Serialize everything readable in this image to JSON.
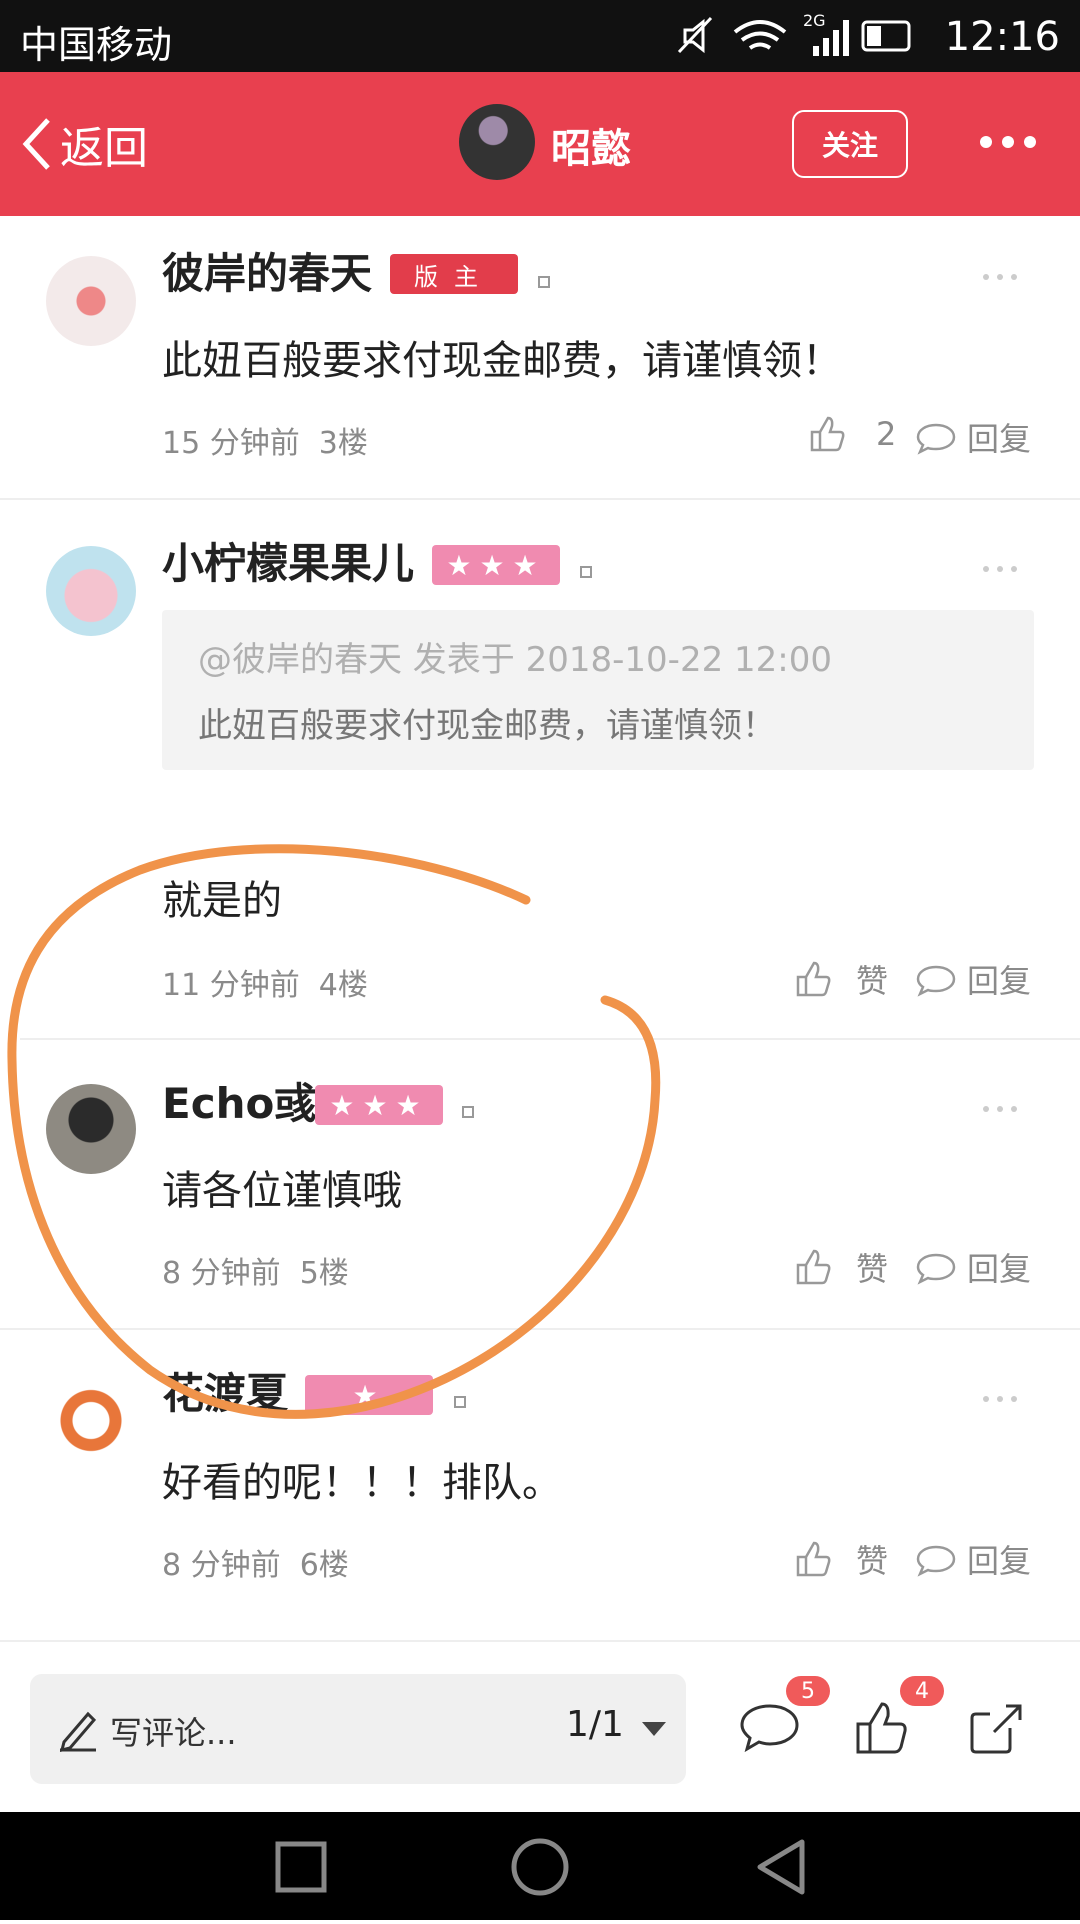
{
  "status_bar": {
    "carrier": "中国移动",
    "network": "2G",
    "time": "12:16"
  },
  "header": {
    "back_label": "返回",
    "username": "昭懿",
    "follow_label": "关注"
  },
  "comments": [
    {
      "username": "彼岸的春天",
      "badge": "版主",
      "text": "此妞百般要求付现金邮费，请谨慎领！",
      "time": "15 分钟前",
      "floor": "3楼",
      "like_label": "2",
      "reply_label": "回复"
    },
    {
      "username": "小柠檬果果儿",
      "badge": "★★★",
      "quote_header": "@彼岸的春天 发表于 2018-10-22 12:00",
      "quote_text": "此妞百般要求付现金邮费，请谨慎领！",
      "text": "就是的",
      "time": "11 分钟前",
      "floor": "4楼",
      "like_label": "赞",
      "reply_label": "回复"
    },
    {
      "username": "Echo彧",
      "badge": "★★★",
      "text": "请各位谨慎哦",
      "time": "8 分钟前",
      "floor": "5楼",
      "like_label": "赞",
      "reply_label": "回复"
    },
    {
      "username": "花渡夏",
      "badge": "★",
      "text": "好看的呢！！！排队。",
      "time": "8 分钟前",
      "floor": "6楼",
      "like_label": "赞",
      "reply_label": "回复"
    }
  ],
  "bottom_bar": {
    "input_placeholder": "写评论...",
    "page_indicator": "1/1",
    "comment_count": "5",
    "like_count": "4"
  },
  "colors": {
    "brand": "#e8404f",
    "annotation": "#f0934a",
    "badge_mod": "#e23d4b",
    "badge_stars": "#f08bb0"
  }
}
